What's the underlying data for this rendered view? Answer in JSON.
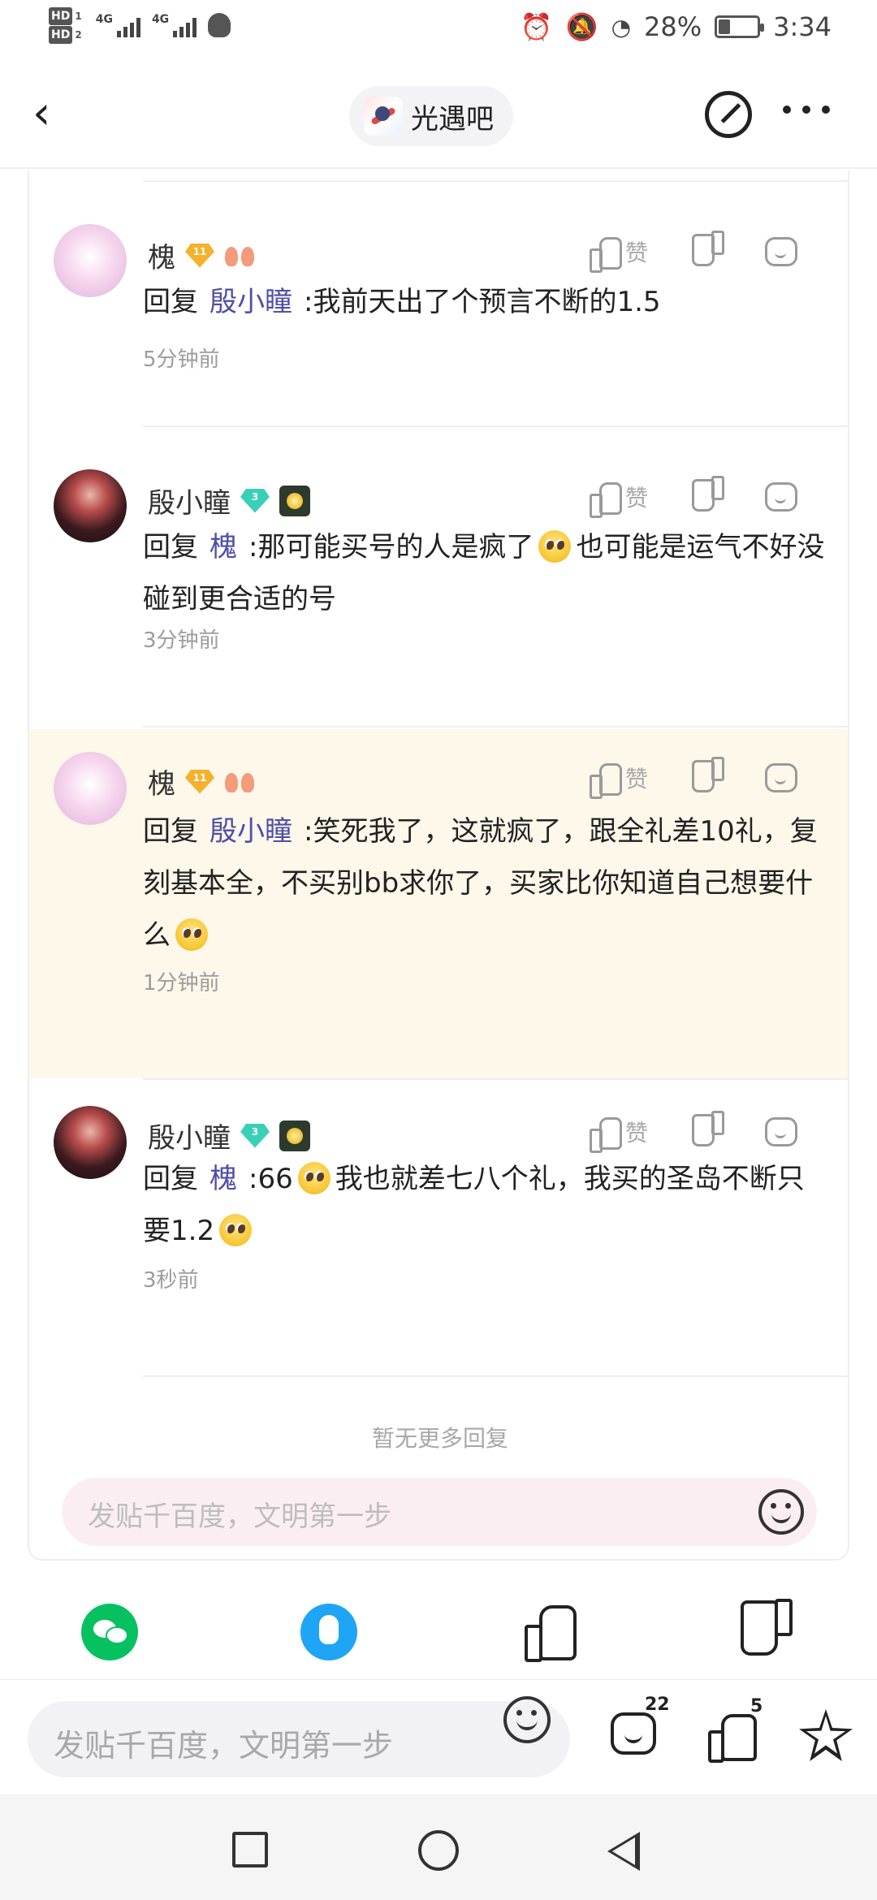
{
  "status_bar": {
    "hd1": "HD",
    "hd1_sub": "1",
    "hd2": "HD",
    "hd2_sub": "2",
    "net1": "4G",
    "net2": "4G",
    "battery_percent": "28%",
    "battery_level": 0.28,
    "time": "3:34",
    "icons": [
      "alarm-icon",
      "mute-icon",
      "data-saver-icon",
      "battery-icon",
      "qq-status-icon"
    ]
  },
  "header": {
    "forum_name": "光遇吧"
  },
  "comments": [
    {
      "author": "槐",
      "level": "11",
      "reply_prefix": "回复",
      "reply_to": "殷小瞳",
      "text": ":我前天出了个预言不断的1.5",
      "time": "5分钟前",
      "like_label": "赞",
      "highlighted": false
    },
    {
      "author": "殷小瞳",
      "level": "3",
      "reply_prefix": "回复",
      "reply_to": "槐",
      "text_part1": ":那可能买号的人是疯了",
      "text_part2": "也可能是运气不好没碰到更合适的号",
      "time": "3分钟前",
      "like_label": "赞",
      "highlighted": false
    },
    {
      "author": "槐",
      "level": "11",
      "reply_prefix": "回复",
      "reply_to": "殷小瞳",
      "text": ":笑死我了，这就疯了，跟全礼差10礼，复刻基本全，不买别bb求你了，买家比你知道自己想要什么",
      "time": "1分钟前",
      "like_label": "赞",
      "highlighted": true
    },
    {
      "author": "殷小瞳",
      "level": "3",
      "reply_prefix": "回复",
      "reply_to": "槐",
      "text_part1": ":66",
      "text_part2": "我也就差七八个礼，我买的圣岛不断只要1.2",
      "time": "3秒前",
      "like_label": "赞",
      "highlighted": false
    }
  ],
  "no_more_replies": "暂无更多回复",
  "card_input_placeholder": "发贴千百度，文明第一步",
  "share_row": {
    "items": [
      "wechat-icon",
      "qq-icon",
      "thumbs-up-icon",
      "thumbs-down-icon"
    ]
  },
  "bottom_bar": {
    "input_placeholder": "发贴千百度，文明第一步",
    "comment_count": "22",
    "like_count": "5"
  }
}
